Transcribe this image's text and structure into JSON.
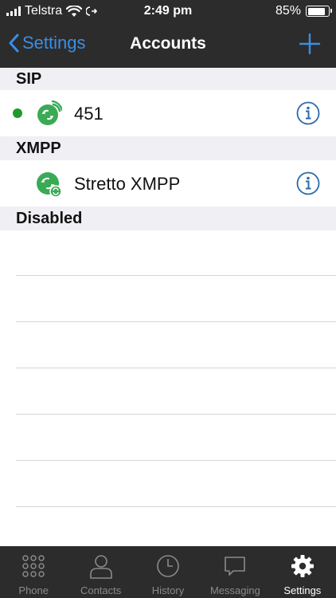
{
  "status_bar": {
    "carrier": "Telstra",
    "time": "2:49 pm",
    "battery_percent": "85%",
    "battery_level": 0.85
  },
  "nav": {
    "back_label": "Settings",
    "title": "Accounts"
  },
  "sections": {
    "sip": {
      "title": "SIP",
      "accounts": [
        {
          "name": "451",
          "status": "online",
          "status_color": "#1f9a2c"
        }
      ]
    },
    "xmpp": {
      "title": "XMPP",
      "accounts": [
        {
          "name": "Stretto XMPP"
        }
      ]
    },
    "disabled": {
      "title": "Disabled"
    }
  },
  "tabs": [
    {
      "label": "Phone",
      "icon": "keypad-icon"
    },
    {
      "label": "Contacts",
      "icon": "person-icon"
    },
    {
      "label": "History",
      "icon": "clock-icon"
    },
    {
      "label": "Messaging",
      "icon": "speech-bubble-icon"
    },
    {
      "label": "Settings",
      "icon": "gear-icon",
      "active": true
    }
  ],
  "colors": {
    "accent": "#3a8ee6",
    "bar_background": "#2c2c2c",
    "account_icon_green": "#3aaa55",
    "info_icon": "#2a6aa8"
  }
}
